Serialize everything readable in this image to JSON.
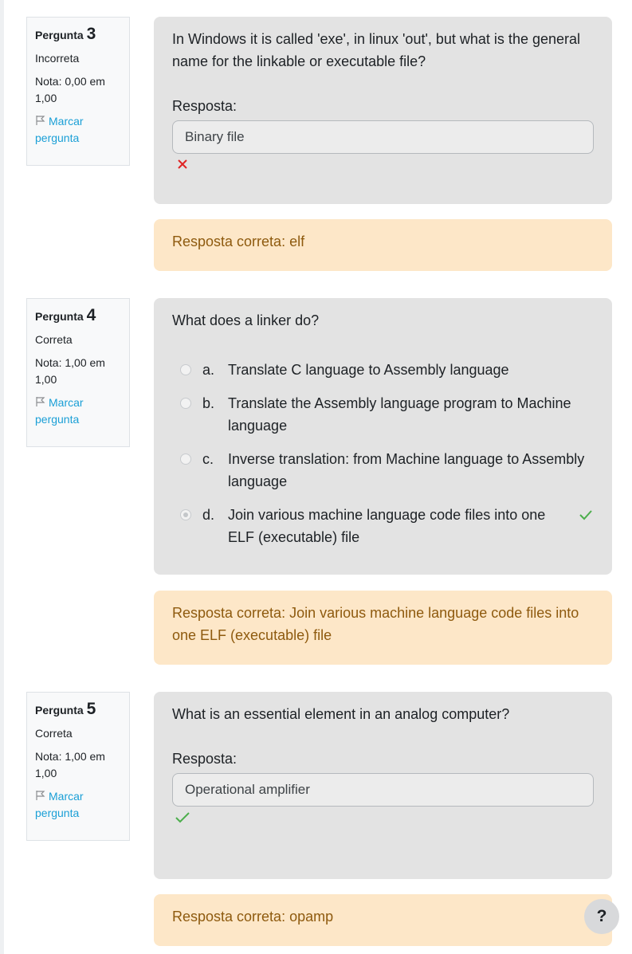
{
  "questions": [
    {
      "label": "Pergunta",
      "number": "3",
      "state": "Incorreta",
      "grade": "Nota: 0,00 em 1,00",
      "flag_label": "Marcar pergunta",
      "text": "In Windows it is called 'exe', in linux 'out', but what is the general name for the linkable or executable file?",
      "response_label": "Resposta:",
      "answer": "Binary file",
      "mark_icon": "cross-icon",
      "feedback": "Resposta correta: elf"
    },
    {
      "label": "Pergunta",
      "number": "4",
      "state": "Correta",
      "grade": "Nota: 1,00 em 1,00",
      "flag_label": "Marcar pergunta",
      "text": "What does a linker do?",
      "options": [
        {
          "letter": "a.",
          "text": "Translate C language to Assembly language",
          "selected": false
        },
        {
          "letter": "b.",
          "text": "Translate the Assembly language program to Machine language",
          "selected": false
        },
        {
          "letter": "c.",
          "text": "Inverse translation: from Machine language to Assembly language",
          "selected": false
        },
        {
          "letter": "d.",
          "text": "Join various machine language code files into one ELF (executable) file",
          "selected": true
        }
      ],
      "feedback": "Resposta correta: Join various machine language code files into one ELF (executable) file"
    },
    {
      "label": "Pergunta",
      "number": "5",
      "state": "Correta",
      "grade": "Nota: 1,00 em 1,00",
      "flag_label": "Marcar pergunta",
      "text": "What is an essential element in an analog computer?",
      "response_label": "Resposta:",
      "answer": "Operational amplifier",
      "mark_icon": "check-icon",
      "feedback": "Resposta correta: opamp"
    }
  ],
  "help_button": "?",
  "colors": {
    "formulation_bg": "#e3e3e3",
    "feedback_bg": "#fde7c8",
    "feedback_text": "#8e5a0e",
    "link": "#1a9fd6",
    "correct": "#4cae4c",
    "incorrect": "#e02424"
  }
}
